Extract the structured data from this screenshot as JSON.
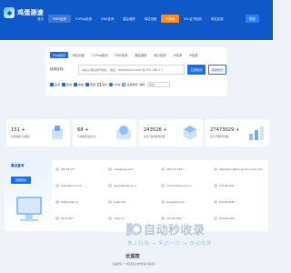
{
  "header": {
    "logo_name": "鸡蛋测速",
    "logo_sub": "www.jdcesu.com",
    "nav": [
      "首页",
      "PING检测",
      "TCPing检测",
      "DNS查询",
      "路由追踪",
      "网站测速",
      "IP查询",
      "SSL证书检测",
      "域名检测",
      "查询历史"
    ],
    "nav_hot_index": 6,
    "login": "登录"
  },
  "search": {
    "tabs": [
      "Ping检测",
      "网站测速",
      "TCPing检测",
      "DNS查询",
      "路由追踪",
      "端口检测",
      "IP查询",
      "IP信息"
    ],
    "label": "检测目标:",
    "placeholder": "请输入域名或IP地址，例如：www.qianlu.com 或 192.168.1.1",
    "btn_primary": "立即检测",
    "btn_secondary": "高级检测",
    "options": [
      {
        "label": "全选",
        "checked": true
      },
      {
        "label": "移动",
        "checked": true
      },
      {
        "label": "电信",
        "checked": true
      },
      {
        "label": "联通",
        "checked": true
      },
      {
        "label": "海外",
        "checked": false
      }
    ],
    "radios": [
      {
        "label": "ICMP",
        "on": true
      },
      {
        "label": "设置数值",
        "on": false
      }
    ],
    "extra_label": "超时",
    "extra_placeholder": "请输入"
  },
  "stats": [
    {
      "num": "151 +",
      "label": "全国测速节点覆盖"
    },
    {
      "num": "68 +",
      "label": "全球覆盖测速节点"
    },
    {
      "num": "243526 +",
      "label": "累计已帮助检测次数"
    },
    {
      "num": "27473029 +",
      "label": "累计全部检测次数"
    }
  ],
  "history": {
    "title": "最近查询",
    "button": "查看更多",
    "rows": [
      [
        "192.52.10.*",
        "cnewswing.com",
        "145.172.223.*",
        "thgsdsamclapan.yta.bru.chrtr.com"
      ],
      [
        "www.alirum.com",
        "www.eduspace.cn",
        "bso.domtree.com.cn",
        "172.36.204.*"
      ],
      [
        "bsf.taxmax.cn",
        "eujian.biz",
        "bhuyaand.com",
        "154.29.208.*"
      ],
      [
        "10.47.20.*",
        "jutipx.cn",
        "172.36.208.*",
        "154.29.208.*"
      ]
    ]
  },
  "watermark": {
    "title": "自动秒收录",
    "sub": "做上链接 → 来访一次 → 自动收录",
    "brand": "云监控",
    "copyright": "版权所有 © 鸡蛋测速 未经授权不得转载"
  },
  "colors": {
    "primary": "#1a6cf0",
    "header": "#0f58c8",
    "hot": "#ff8a1f"
  }
}
